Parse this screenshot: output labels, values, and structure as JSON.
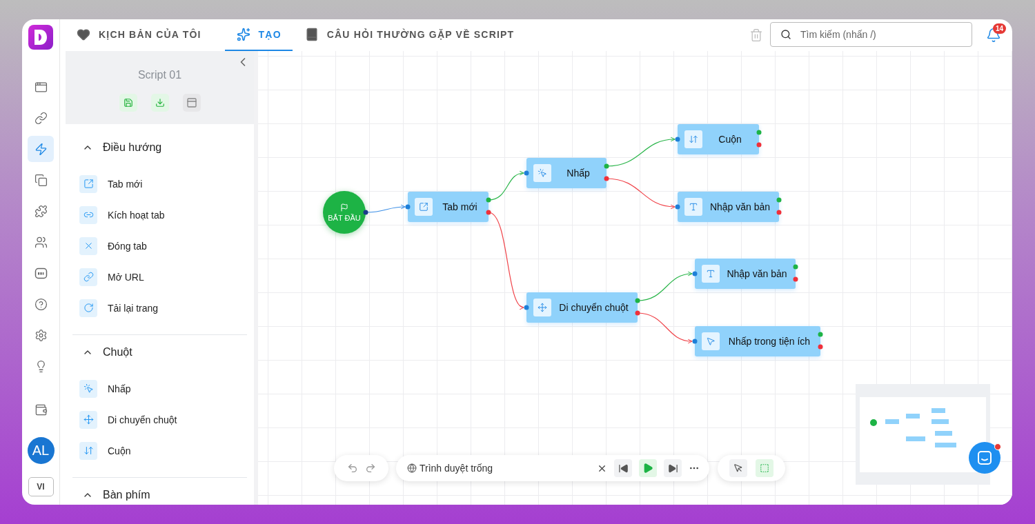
{
  "rail": {
    "items": [
      {
        "kind": "browser",
        "selected": false
      },
      {
        "kind": "link",
        "selected": false
      },
      {
        "kind": "flow",
        "selected": true
      },
      {
        "kind": "copy",
        "selected": false
      },
      {
        "kind": "puzzle",
        "selected": false
      },
      {
        "kind": "users",
        "selected": false
      },
      {
        "kind": "api",
        "selected": false
      },
      {
        "kind": "help",
        "selected": false
      },
      {
        "kind": "settings",
        "selected": false
      },
      {
        "kind": "bulb",
        "selected": false
      }
    ],
    "avatar": "AL",
    "language": "VI"
  },
  "tabs": [
    {
      "kind": "heart",
      "label": "KỊCH BẢN CỦA TÔI",
      "selected": false
    },
    {
      "kind": "sparkles",
      "label": "TẠO",
      "selected": true
    },
    {
      "kind": "book",
      "label": "CÂU HỎI THƯỜNG GẶP VỀ SCRIPT",
      "selected": false
    }
  ],
  "search": {
    "placeholder": "Tìm kiếm (nhấn /)"
  },
  "notifications": {
    "count": "14"
  },
  "panel": {
    "title": "Script 01",
    "sections": [
      {
        "title": "Điều hướng",
        "expanded": true,
        "items": [
          {
            "kind": "new-tab",
            "label": "Tab mới"
          },
          {
            "kind": "link",
            "label": "Kích hoạt tab"
          },
          {
            "kind": "close",
            "label": "Đóng tab"
          },
          {
            "kind": "url",
            "label": "Mở URL"
          },
          {
            "kind": "reload",
            "label": "Tải lại trang"
          }
        ]
      },
      {
        "title": "Chuột",
        "expanded": true,
        "items": [
          {
            "kind": "click",
            "label": "Nhấp"
          },
          {
            "kind": "move",
            "label": "Di chuyển chuột"
          },
          {
            "kind": "scroll",
            "label": "Cuộn"
          }
        ]
      },
      {
        "title": "Bàn phím",
        "expanded": true
      }
    ]
  },
  "flow": {
    "nodes": [
      {
        "kind": "start",
        "label": "BẮT ĐẦU"
      },
      {
        "kind": "new-tab",
        "label": "Tab mới"
      },
      {
        "kind": "click",
        "label": "Nhấp"
      },
      {
        "kind": "scroll",
        "label": "Cuộn"
      },
      {
        "kind": "text",
        "label": "Nhập văn bản"
      },
      {
        "kind": "move",
        "label": "Di chuyển chuột"
      },
      {
        "kind": "text",
        "label": "Nhập văn bản"
      },
      {
        "kind": "pointer",
        "label": "Nhấp trong tiện ích"
      }
    ]
  },
  "runner": {
    "browser": "Trình duyệt trống"
  }
}
